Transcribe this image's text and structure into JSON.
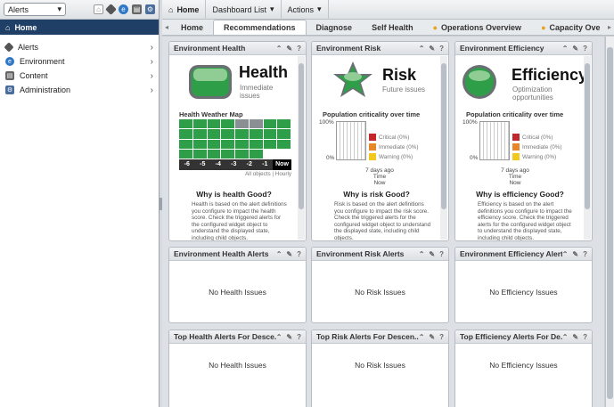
{
  "left": {
    "selector_value": "Alerts",
    "home_label": "Home",
    "nav": [
      {
        "label": "Alerts",
        "icon": "alert-diamond-icon",
        "color": "#555555"
      },
      {
        "label": "Environment",
        "icon": "globe-icon",
        "color": "#2f77c7"
      },
      {
        "label": "Content",
        "icon": "content-icon",
        "color": "#666666"
      },
      {
        "label": "Administration",
        "icon": "admin-icon",
        "color": "#4a6d9c"
      }
    ]
  },
  "topbar": {
    "home": "Home",
    "dashboard_list": "Dashboard List",
    "actions": "Actions"
  },
  "tabs": [
    "Home",
    "Recommendations",
    "Diagnose",
    "Self Health",
    "Operations Overview",
    "Capacity Ove"
  ],
  "active_tab": "Recommendations",
  "widgets": {
    "health": {
      "title": "Environment Health",
      "big": "Health",
      "sub1": "Immediate",
      "sub2": "issues",
      "map_title": "Health Weather Map",
      "axis": [
        "-6",
        "-5",
        "-4",
        "-3",
        "-2",
        "-1",
        "Now"
      ],
      "axis_note": "All objects | Hourly",
      "why_title": "Why is health Good?",
      "why_text": "Health is based on the alert definitions you configure to impact the health score. Check the triggered alerts for the configured widget object to understand the displayed state, including child objects."
    },
    "risk": {
      "title": "Environment Risk",
      "big": "Risk",
      "sub1": "Future issues",
      "chart_title": "Population criticality over time",
      "y_top": "100%",
      "y_bottom": "0%",
      "x1": "7 days ago",
      "x2": "Time",
      "x3": "Now",
      "legend": [
        "Critical (0%)",
        "Immediate (0%)",
        "Warning (0%)"
      ],
      "why_title": "Why is risk Good?",
      "why_text": "Risk is based on the alert definitions you configure to impact the risk score. Check the triggered alerts for the configured widget object to understand the displayed state, including child objects."
    },
    "efficiency": {
      "title": "Environment Efficiency",
      "big": "Efficiency",
      "sub1": "Optimization",
      "sub2": "opportunities",
      "chart_title": "Population criticality over time",
      "y_top": "100%",
      "y_bottom": "0%",
      "x1": "7 days ago",
      "x2": "Time",
      "x3": "Now",
      "legend": [
        "Critical (0%)",
        "Immediate (0%)",
        "Warning (0%)"
      ],
      "why_title": "Why is efficiency Good?",
      "why_text": "Efficiency is based on the alert definitions you configure to impact the efficiency score. Check the triggered alerts for the configured widget object to understand the displayed state, including child objects."
    },
    "health_alerts": {
      "title": "Environment Health Alerts",
      "msg": "No Health Issues"
    },
    "risk_alerts": {
      "title": "Environment Risk Alerts",
      "msg": "No Risk Issues"
    },
    "eff_alerts": {
      "title": "Environment Efficiency Alerts",
      "msg": "No Efficiency Issues"
    },
    "top_health": {
      "title": "Top Health Alerts For Desce...",
      "msg": "No Health Issues"
    },
    "top_risk": {
      "title": "Top Risk Alerts For Descen...",
      "msg": "No Risk Issues"
    },
    "top_eff": {
      "title": "Top Efficiency Alerts For De...",
      "msg": "No Efficiency Issues"
    }
  },
  "colors": {
    "good": "#2e9e48",
    "gray": "#8a8f94",
    "critical": "#c0282d",
    "immediate": "#e8862a",
    "warning": "#f2c81f",
    "header": "#1f3f66"
  }
}
